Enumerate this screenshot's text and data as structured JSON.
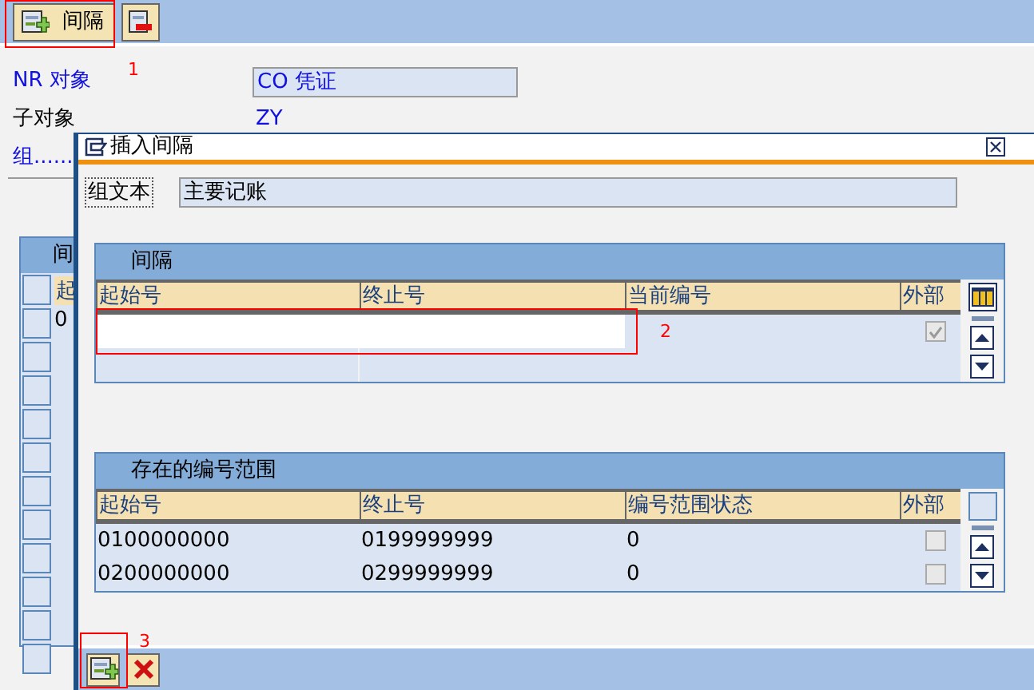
{
  "toolbar": {
    "buttons": [
      {
        "kind": "add",
        "label": "间隔"
      },
      {
        "kind": "delete"
      }
    ]
  },
  "fields": [
    {
      "label": "NR 对象",
      "link": true,
      "value": "CO 凭证",
      "kind": "input"
    },
    {
      "label": "子对象",
      "link": false,
      "value": "ZY",
      "kind": "text"
    },
    {
      "label": "组......",
      "link": true
    }
  ],
  "background_table": {
    "title": "间",
    "columns": [
      "起"
    ],
    "rows": [
      [
        "0"
      ]
    ]
  },
  "dialog": {
    "title": "插入间隔",
    "group_text": {
      "label": "组文本",
      "value": "主要记账"
    },
    "interval_table": {
      "title": "间隔",
      "columns": [
        "起始号",
        "终止号",
        "当前编号",
        "外部"
      ],
      "rows": [
        {
          "kind": "input",
          "external": {
            "checked": true,
            "disabled": true
          }
        }
      ]
    },
    "ranges_table": {
      "title": "存在的编号范围",
      "columns": [
        "起始号",
        "终止号",
        "编号范围状态",
        "外部"
      ],
      "rows": [
        {
          "cells": [
            "0100000000",
            "0199999999",
            "0"
          ],
          "external": {
            "checked": false,
            "disabled": true
          }
        },
        {
          "cells": [
            "0200000000",
            "0299999999",
            "0"
          ],
          "external": {
            "checked": false,
            "disabled": true
          }
        }
      ]
    },
    "buttons": [
      {
        "kind": "add"
      },
      {
        "kind": "cancel"
      }
    ]
  },
  "annotations": [
    {
      "label": "1"
    },
    {
      "label": "2"
    },
    {
      "label": "3"
    }
  ]
}
